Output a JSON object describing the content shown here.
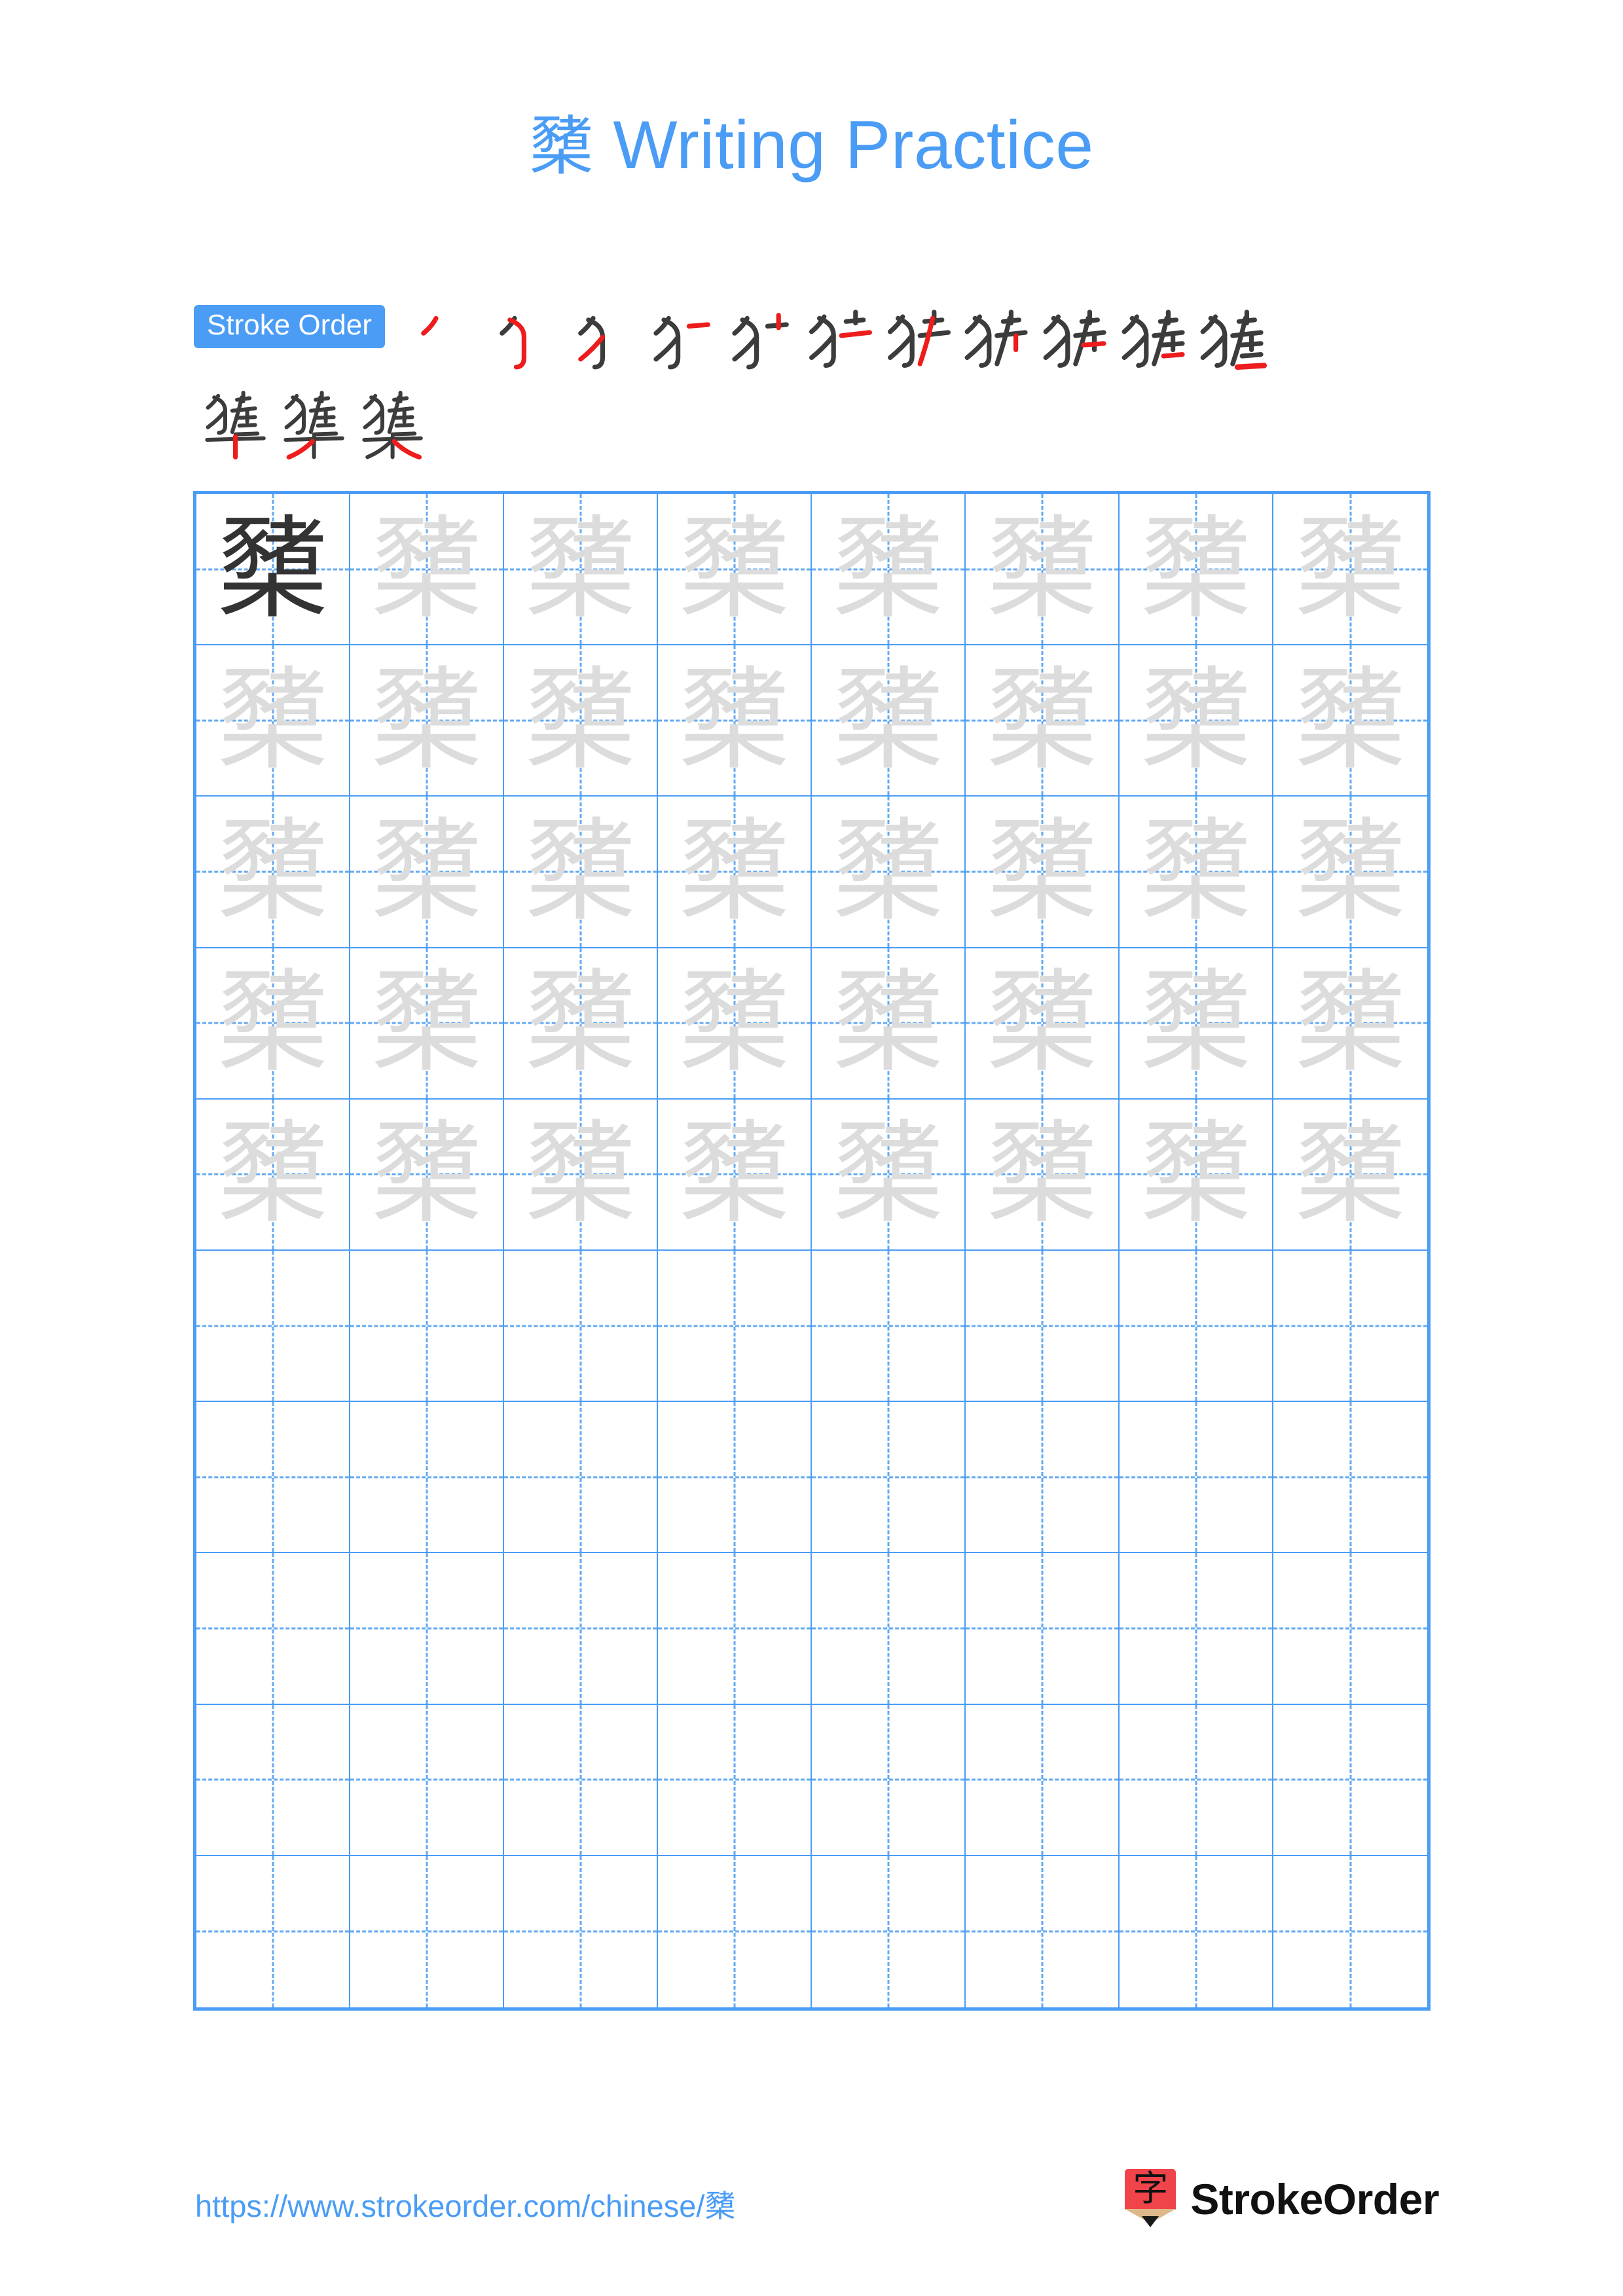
{
  "document": {
    "character": "櫫",
    "title_suffix": "Writing Practice",
    "accent_color": "#4a9cf5",
    "trace_color": "#dcdcdc",
    "model_color": "#333333"
  },
  "stroke_order": {
    "badge_label": "Stroke Order",
    "total_strokes": 14,
    "steps_row1": [
      "stroke-1",
      "stroke-2",
      "stroke-3",
      "stroke-4",
      "stroke-5",
      "stroke-6",
      "stroke-7",
      "stroke-8",
      "stroke-9",
      "stroke-10",
      "stroke-11"
    ],
    "steps_row2": [
      "stroke-12",
      "stroke-13",
      "stroke-14"
    ],
    "new_stroke_color": "#ee1c1c",
    "existing_stroke_color": "#3c3c3c"
  },
  "practice_grid": {
    "columns": 8,
    "rows": 10,
    "filled_rows": 5,
    "empty_rows": 5,
    "model_cell_index": 0,
    "cell_character": "櫫"
  },
  "footer": {
    "url": "https://www.strokeorder.com/chinese/櫫",
    "brand_name": "StrokeOrder",
    "brand_glyph": "字",
    "brand_icon": "pencil-logo-icon"
  }
}
